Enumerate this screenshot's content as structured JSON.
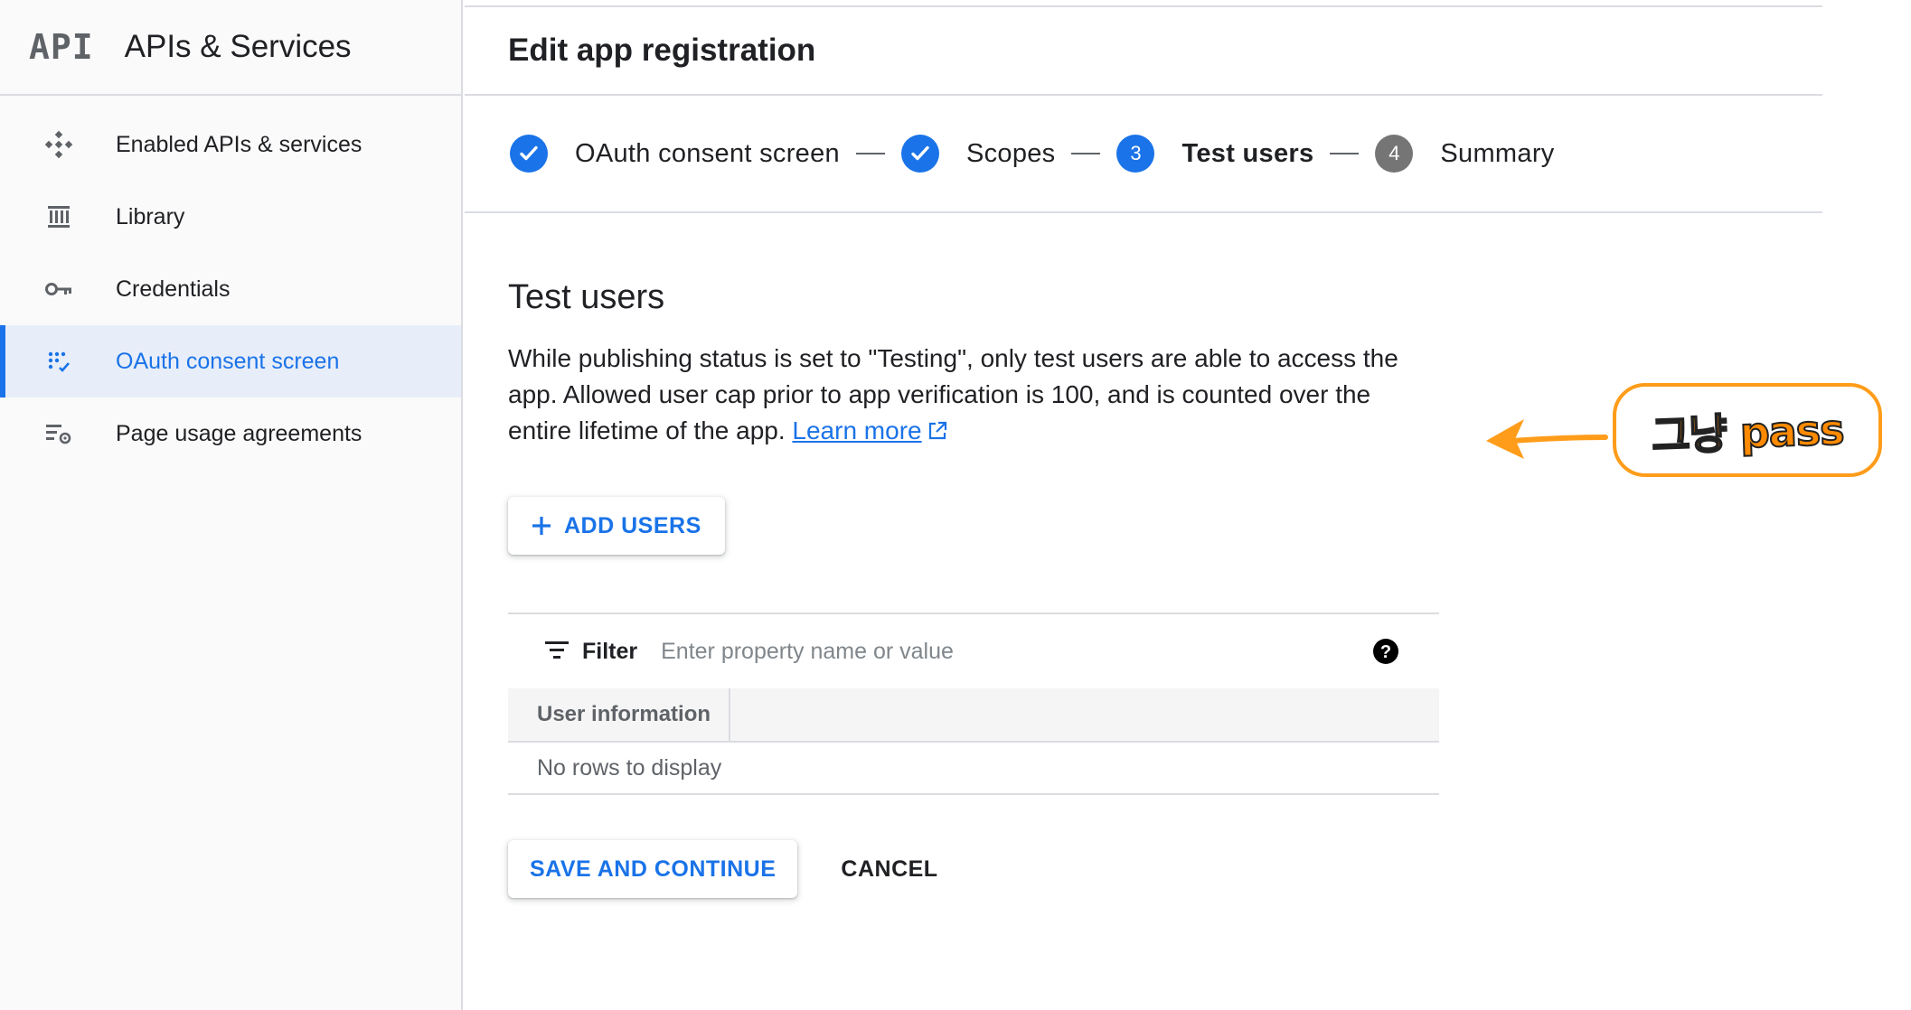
{
  "sidebar": {
    "logo": "API",
    "title": "APIs & Services",
    "items": [
      {
        "label": "Enabled APIs & services",
        "icon": "enabled-apis-icon"
      },
      {
        "label": "Library",
        "icon": "library-icon"
      },
      {
        "label": "Credentials",
        "icon": "key-icon"
      },
      {
        "label": "OAuth consent screen",
        "icon": "oauth-consent-icon",
        "active": true
      },
      {
        "label": "Page usage agreements",
        "icon": "page-usage-icon"
      }
    ]
  },
  "header": {
    "title": "Edit app registration"
  },
  "stepper": {
    "steps": [
      {
        "number": "",
        "label": "OAuth consent screen",
        "state": "done"
      },
      {
        "number": "",
        "label": "Scopes",
        "state": "done"
      },
      {
        "number": "3",
        "label": "Test users",
        "state": "current"
      },
      {
        "number": "4",
        "label": "Summary",
        "state": "pending"
      }
    ]
  },
  "test_users": {
    "title": "Test users",
    "description": "While publishing status is set to \"Testing\", only test users are able to access the app. Allowed user cap prior to app verification is 100, and is counted over the entire lifetime of the app.",
    "learn_more": "Learn more",
    "add_users_label": "ADD USERS"
  },
  "table": {
    "filter_label": "Filter",
    "filter_placeholder": "Enter property name or value",
    "columns": [
      "User information",
      ""
    ],
    "empty_text": "No rows to display"
  },
  "actions": {
    "save_label": "SAVE AND CONTINUE",
    "cancel_label": "CANCEL"
  },
  "annotation": {
    "text": "그냥 pass"
  },
  "colors": {
    "accent": "#1a73e8",
    "annotation_orange": "#ff9c1a",
    "sidebar_active_bg": "#e8eef9"
  }
}
